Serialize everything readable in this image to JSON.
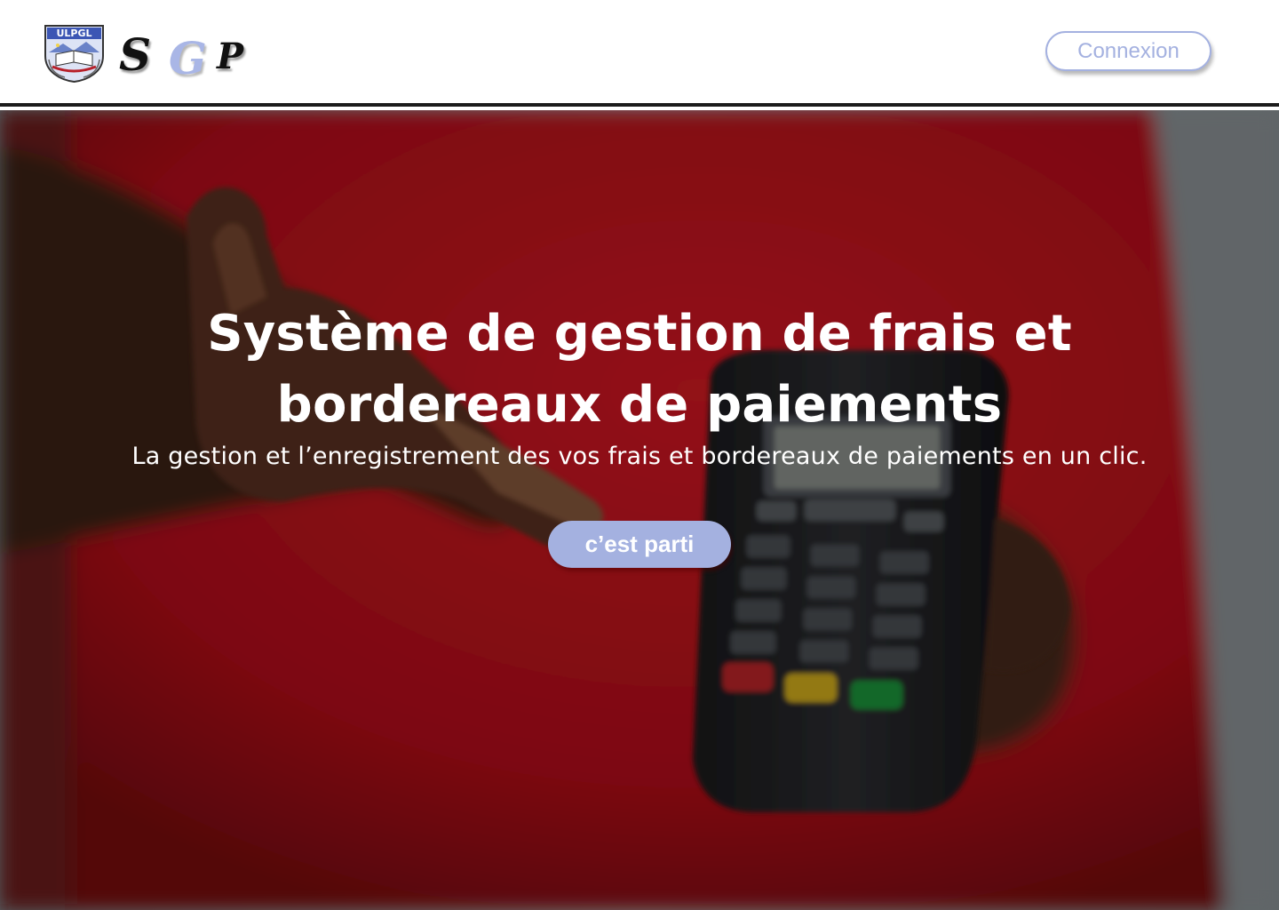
{
  "header": {
    "crest": {
      "label": "ULPGL",
      "icon": "university-crest-logo"
    },
    "brand": {
      "letters": [
        "S",
        "G",
        "P"
      ],
      "colors": {
        "s": "#111111",
        "g": "#a9b6e6",
        "p": "#111111"
      }
    },
    "login_label": "Connexion"
  },
  "hero": {
    "title_line1": "Système de gestion de frais et",
    "title_line2": "bordereaux de paiements",
    "subtitle": "La gestion et l’enregistrement des vos frais et bordereaux de paiements en un clic.",
    "cta_label": "c’est parti",
    "background": "hand-holding-payment-terminal-photo"
  },
  "colors": {
    "accent": "#a4b1e0",
    "header_bg": "#ffffff",
    "header_border": "#1c1c1c",
    "hero_shirt": "#c8141e",
    "text_on_hero": "#ffffff"
  }
}
